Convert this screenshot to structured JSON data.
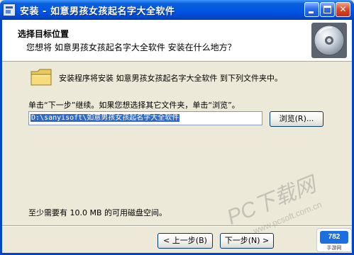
{
  "window": {
    "title": "安装 - 如意男孩女孩起名字大全软件",
    "min_glyph": "",
    "max_glyph": "",
    "close_glyph": "✕"
  },
  "header": {
    "title": "选择目标位置",
    "subtitle": "您想将 如意男孩女孩起名字大全软件 安装在什么地方？",
    "icon": "disc-icon"
  },
  "body": {
    "install_info": "安装程序将安装 如意男孩女孩起名字大全软件 到下列文件夹中。",
    "instruction": "单击“下一步”继续。如果您想选择其它文件夹，单击“浏览”。",
    "path_value": "D:\\sanyisoft\\如意男孩女孩起名字大全软件",
    "browse_label": "浏览(R)...",
    "disk_space": "至少需要有 10.0 MB 的可用磁盘空间。"
  },
  "footer": {
    "back_label": "< 上一步(B)",
    "next_label": "下一步(N) >"
  },
  "watermark": {
    "text": "PC下载网",
    "url": "www.pcsoft.com.cn",
    "badge_logo": "782",
    "badge_sub": "手游网"
  },
  "colors": {
    "titlebar": "#0055e5",
    "face": "#ece9d8",
    "selection": "#316ac5"
  }
}
